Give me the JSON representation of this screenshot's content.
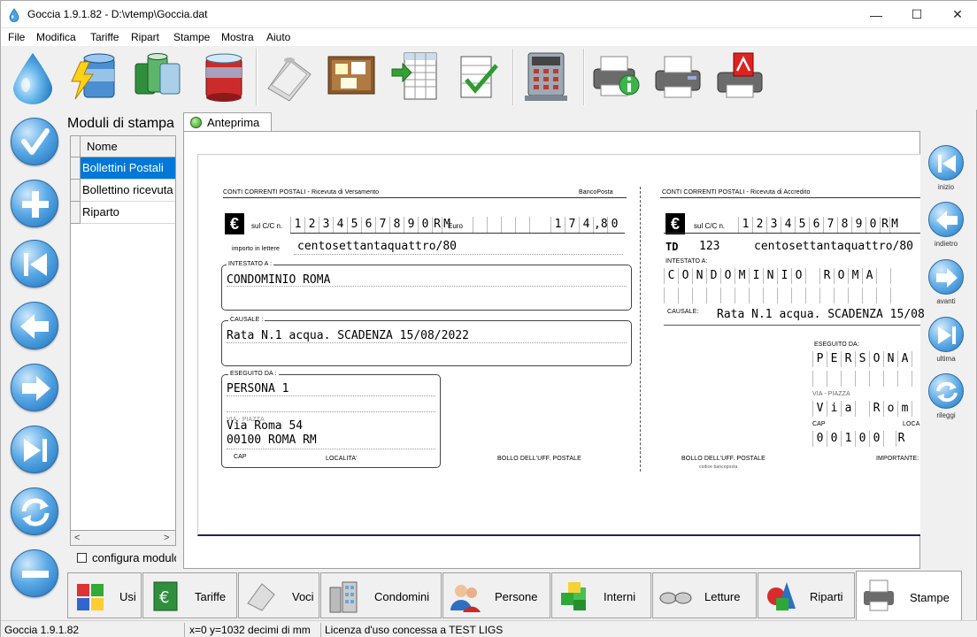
{
  "window": {
    "title": "Goccia 1.9.1.82 - D:\\vtemp\\Goccia.dat",
    "controls": {
      "minimize": "—",
      "maximize": "☐",
      "close": "✕"
    }
  },
  "menu": [
    {
      "label": "File"
    },
    {
      "label": "Modifica"
    },
    {
      "label": "Tariffe"
    },
    {
      "label": "Ripart"
    },
    {
      "label": "Stampe"
    },
    {
      "label": "Mostra"
    },
    {
      "label": "Aiuto"
    }
  ],
  "toolbar_icons": [
    "goccia-logo-icon",
    "database-lightning-icon",
    "database-green-icon",
    "database-red-icon",
    "paper-rolls-icon",
    "bulletin-board-icon",
    "spreadsheet-export-icon",
    "spreadsheet-check-icon",
    "calculator-icon",
    "printer-info-icon",
    "printer-icon",
    "printer-pdf-icon"
  ],
  "left_nav_icons": [
    "confirm-icon",
    "add-icon",
    "first-icon",
    "previous-icon",
    "next-icon",
    "last-icon",
    "refresh-icon",
    "remove-icon"
  ],
  "modules": {
    "title": "Moduli di stampa",
    "column": "Nome",
    "rows": [
      "Bollettini Postali",
      "Bollettino ricevuta",
      "Riparto"
    ],
    "selected": 0,
    "configure_label": "configura modulo"
  },
  "preview": {
    "tab_label": "Anteprima",
    "bollettino": {
      "left_header": "CONTI CORRENTI POSTALI - Ricevuta di Versamento",
      "bancoposta": "BancoPosta",
      "right_header": "CONTI CORRENTI POSTALI - Ricevuta di Accredito",
      "euro_symbol": "€",
      "cc_label": "sul C/C n.",
      "account_digits": [
        "1",
        "2",
        "3",
        "4",
        "5",
        "6",
        "7",
        "8",
        "9",
        "0",
        "R",
        "M"
      ],
      "euro_label": "Euro",
      "amount_digits": [
        "1",
        "7",
        "4",
        ",8",
        "0"
      ],
      "amount_words_label": "importo in lettere",
      "amount_words": "centosettantaquattro/80",
      "td_label": "TD",
      "td_value": "123",
      "intestato_label": "INTESTATO A :",
      "intestato_label_right": "INTESTATO A:",
      "intestato_value": "CONDOMINIO ROMA",
      "intestato_letters": [
        "C",
        "O",
        "N",
        "D",
        "O",
        "M",
        "I",
        "N",
        "I",
        "O",
        "",
        "R",
        "O",
        "M",
        "A"
      ],
      "causale_label": "CAUSALE :",
      "causale_label_right": "CAUSALE:",
      "causale_value": "Rata N.1 acqua.  SCADENZA 15/08/2022",
      "causale_value_right": "Rata N.1 acqua.  SCADENZA 15/08",
      "eseguito_label": "ESEGUITO DA :",
      "eseguito_label_right": "ESEGUITO DA:",
      "payer_name": "PERSONA 1",
      "payer_letters": [
        "P",
        "E",
        "R",
        "S",
        "O",
        "N",
        "A"
      ],
      "via_label": "VIA - PIAZZA",
      "payer_address": "Via Roma 54",
      "via_letters": [
        "V",
        "i",
        "a",
        "",
        "R",
        "o",
        "m"
      ],
      "payer_city": "00100 ROMA RM",
      "cap_label": "CAP",
      "localita_label": "LOCALITA'",
      "localita_short": "LOCA",
      "cap_letters": [
        "0",
        "0",
        "1",
        "0",
        "0"
      ],
      "city_initial": "R",
      "bollo_label": "BOLLO DELL'UFF. POSTALE",
      "bollo_sub": "codice bancoposta",
      "importante_label": "IMPORTANTE:"
    }
  },
  "right_nav": [
    {
      "icon": "first-icon",
      "label": "inizio"
    },
    {
      "icon": "previous-icon",
      "label": "indietro"
    },
    {
      "icon": "next-icon",
      "label": "avanti"
    },
    {
      "icon": "last-icon",
      "label": "ultima"
    },
    {
      "icon": "refresh-icon",
      "label": "rileggi"
    }
  ],
  "bottom_tabs": [
    {
      "label": "Usi",
      "icon": "usi-icon"
    },
    {
      "label": "Tariffe",
      "icon": "tariffe-icon"
    },
    {
      "label": "Voci",
      "icon": "voci-icon"
    },
    {
      "label": "Condomini",
      "icon": "condomini-icon"
    },
    {
      "label": "Persone",
      "icon": "persone-icon"
    },
    {
      "label": "Interni",
      "icon": "interni-icon"
    },
    {
      "label": "Letture",
      "icon": "letture-icon"
    },
    {
      "label": "Riparti",
      "icon": "riparti-icon"
    },
    {
      "label": "Stampe",
      "icon": "stampe-icon"
    }
  ],
  "active_tab": "Stampe",
  "status": {
    "version": "Goccia 1.9.1.82",
    "coords": "x=0 y=1032 decimi di mm",
    "license": "Licenza d'uso concessa a TEST LIGS"
  },
  "colors": {
    "selection": "#0078d7",
    "accent_blue": "#2a6aa6",
    "paper_border": "#222060"
  }
}
